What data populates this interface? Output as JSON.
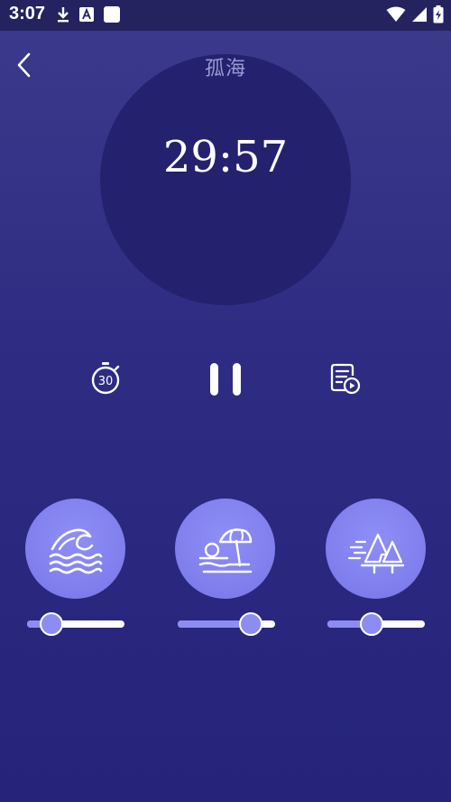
{
  "status_bar": {
    "time": "3:07"
  },
  "header": {
    "title": "孤海"
  },
  "player": {
    "remaining_time": "29:57",
    "timer_button_label": "30"
  },
  "sounds": [
    {
      "name": "waves-icon",
      "volume": 0.25
    },
    {
      "name": "beach-umbrella-icon",
      "volume": 0.75
    },
    {
      "name": "forest-wind-icon",
      "volume": 0.45
    }
  ],
  "colors": {
    "background": "#2e2c82",
    "circle": "#24226e",
    "accent": "#8d8cf2",
    "title": "#9a9ad6"
  }
}
